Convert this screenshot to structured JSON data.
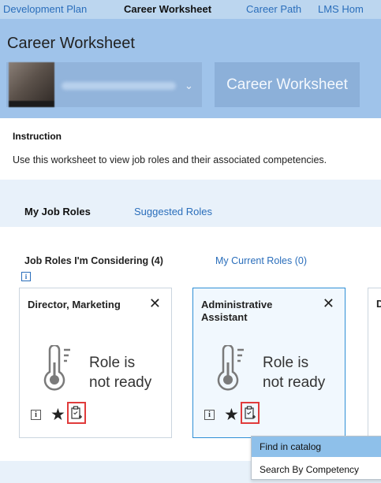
{
  "nav": {
    "tabs": [
      {
        "label": "Development Plan",
        "active": false
      },
      {
        "label": "Career Worksheet",
        "active": true
      },
      {
        "label": "Career Path",
        "active": false
      },
      {
        "label": "LMS Hom",
        "active": false
      }
    ]
  },
  "header": {
    "title": "Career Worksheet",
    "worksheet_button": "Career Worksheet"
  },
  "instruction": {
    "title": "Instruction",
    "text": "Use this worksheet to view job roles and their associated competencies."
  },
  "tabs": {
    "my_job_roles": "My Job Roles",
    "suggested_roles": "Suggested Roles"
  },
  "subtabs": {
    "considering": "Job Roles I'm Considering (4)",
    "current": "My Current Roles (0)"
  },
  "cards": [
    {
      "title": "Director, Marketing",
      "status": "Role is\nnot ready",
      "selected": false
    },
    {
      "title": "Administrative Assistant",
      "status": "Role is\nnot ready",
      "selected": true
    }
  ],
  "peek_card": {
    "title_initial": "D"
  },
  "dropdown": {
    "items": [
      "Find in catalog",
      "Search By Competency"
    ]
  },
  "icons": {
    "info": "info-icon",
    "star": "star-icon",
    "catalog": "clipboard-add-icon",
    "thermometer": "thermometer-icon",
    "close": "close-icon",
    "chevron": "chevron-down-icon"
  },
  "colors": {
    "header_bg": "#9fc3ea",
    "nav_bg": "#bcd6ef",
    "link": "#2a6ebb",
    "highlight_border": "#e03b3b",
    "selected_card_border": "#2f8fd6",
    "menu_highlight": "#8ec0ea"
  }
}
